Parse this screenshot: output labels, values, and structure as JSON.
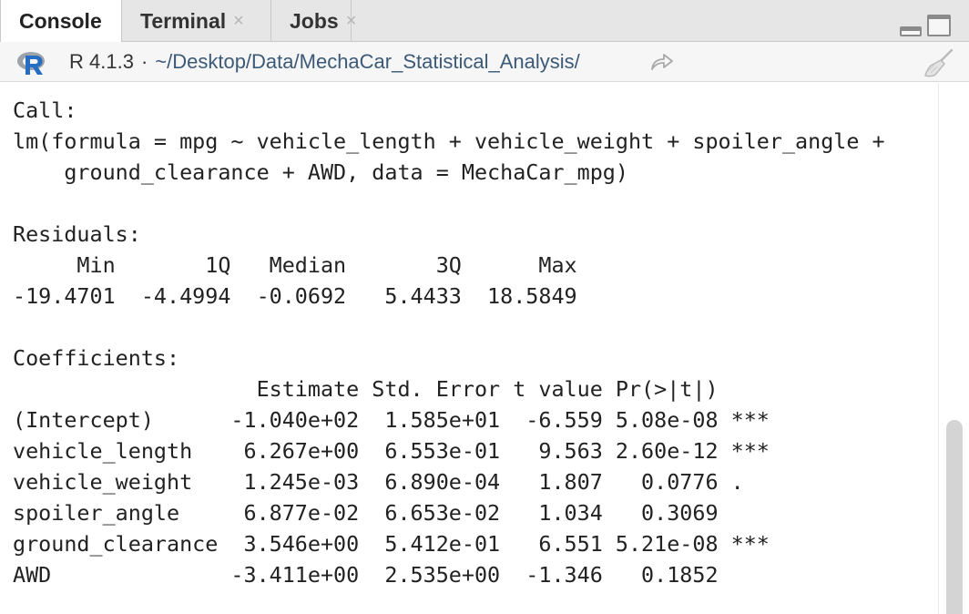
{
  "tabs": [
    {
      "label": "Console",
      "active": true,
      "closable": false
    },
    {
      "label": "Terminal",
      "active": false,
      "closable": true,
      "close_glyph": "×"
    },
    {
      "label": "Jobs",
      "active": false,
      "closable": true,
      "close_glyph": "×"
    }
  ],
  "pathbar": {
    "r_version": "R 4.1.3",
    "separator": "·",
    "working_dir": "~/Desktop/Data/MechaCar_Statistical_Analysis/"
  },
  "icons": {
    "r_logo": "r-logo-icon",
    "go_to_dir": "go-to-directory-icon",
    "clear_console": "broom-icon",
    "minimize": "minimize-icon",
    "maximize": "maximize-icon"
  },
  "colors": {
    "r_logo_blue": "#276dc2",
    "r_logo_grey": "#9ea3a8",
    "path_text": "#3c5a78",
    "tabbar_bg": "#e6e6e6"
  },
  "console": {
    "lines": [
      "Call:",
      "lm(formula = mpg ~ vehicle_length + vehicle_weight + spoiler_angle +",
      "    ground_clearance + AWD, data = MechaCar_mpg)",
      "",
      "Residuals:",
      "     Min       1Q   Median       3Q      Max ",
      "-19.4701  -4.4994  -0.0692   5.4433  18.5849 ",
      "",
      "Coefficients:",
      "                   Estimate Std. Error t value Pr(>|t|)    ",
      "(Intercept)      -1.040e+02  1.585e+01  -6.559 5.08e-08 ***",
      "vehicle_length    6.267e+00  6.553e-01   9.563 2.60e-12 ***",
      "vehicle_weight    1.245e-03  6.890e-04   1.807   0.0776 .  ",
      "spoiler_angle     6.877e-02  6.653e-02   1.034   0.3069    ",
      "ground_clearance  3.546e+00  5.412e-01   6.551 5.21e-08 ***",
      "AWD              -3.411e+00  2.535e+00  -1.346   0.1852    ",
      ""
    ]
  }
}
